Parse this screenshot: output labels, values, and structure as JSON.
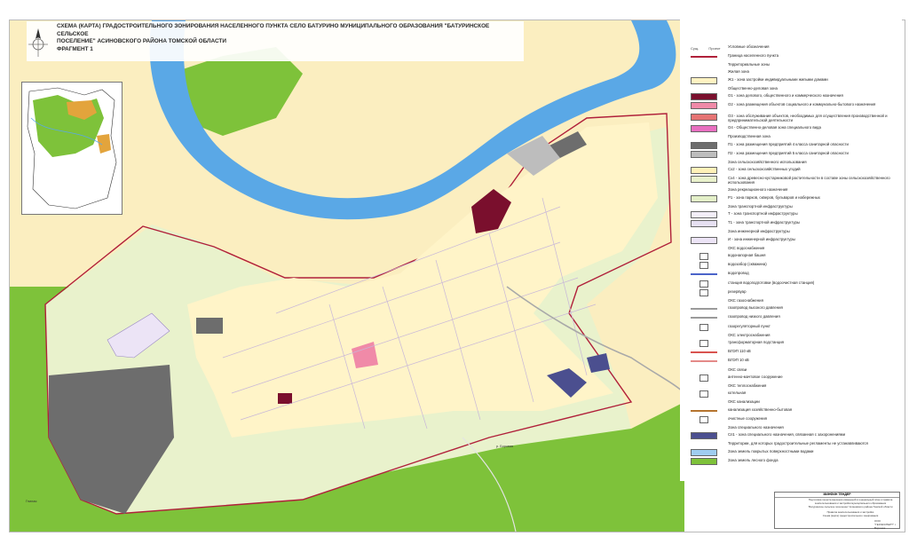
{
  "title": {
    "line1": "СХЕМА (КАРТА) ГРАДОСТРОИТЕЛЬНОГО ЗОНИРОВАНИЯ НАСЕЛЕННОГО ПУНКТА СЕЛО БАТУРИНО МУНИЦИПАЛЬНОГО ОБРАЗОВАНИЯ \"БАТУРИНСКОЕ СЕЛЬСКОЕ",
    "line2": "ПОСЕЛЕНИЕ\" АСИНОВСКОГО РАЙОНА ТОМСКОЙ ОБЛАСТИ",
    "line3": "ФРАГМЕНТ 1"
  },
  "map_labels": {
    "river_label": "р. Боровая",
    "left_river_label": "Гнилая"
  },
  "legend": {
    "head_col1": "Сущ.",
    "head_col2": "Проект",
    "title": "Условные обозначения",
    "items": [
      {
        "section": false,
        "label": "Граница населенного пункта",
        "color": "#b0203a",
        "style": "line"
      },
      {
        "section": true,
        "label": "Территориальные зоны"
      },
      {
        "section": true,
        "label": "Жилая зона"
      },
      {
        "section": false,
        "label": "Ж1 - зона застройки индивидуальными жилыми домами",
        "color": "#fff3c2",
        "style": "fill"
      },
      {
        "section": true,
        "label": "Общественно-деловая зона"
      },
      {
        "section": false,
        "label": "О1 - зона делового, общественного и коммерческого назначения",
        "color": "#7a0f2d",
        "style": "fill"
      },
      {
        "section": false,
        "label": "О2 - зона размещения объектов социального и коммунально-бытового назначения",
        "color": "#f08aa8",
        "style": "fill"
      },
      {
        "section": false,
        "label": "О3 - зона обслуживания объектов, необходимых для осуществления производственной и предпринимательской деятельности",
        "color": "#e57373",
        "style": "fill"
      },
      {
        "section": false,
        "label": "О4 - Общественно-деловая зона специального вида",
        "color": "#e86fc0",
        "style": "fill"
      },
      {
        "section": true,
        "label": "Производственная зона"
      },
      {
        "section": false,
        "label": "П1 - зона размещения предприятий 4 класса санитарной опасности",
        "color": "#6d6d6d",
        "style": "fill"
      },
      {
        "section": false,
        "label": "П2 - зона размещения предприятий 5 класса санитарной опасности",
        "color": "#bdbdbd",
        "style": "fill"
      },
      {
        "section": true,
        "label": "Зона сельскохозяйственного использования"
      },
      {
        "section": false,
        "label": "Сх2 - зона сельскохозяйственных угодий",
        "color": "#fff1b8",
        "style": "fill"
      },
      {
        "section": false,
        "label": "Сх4 - зона древесно-кустарниковой растительности в составе зоны сельскохозяйственного использования",
        "color": "#e9f2cc",
        "style": "fill"
      },
      {
        "section": true,
        "label": "Зона рекреационного назначения"
      },
      {
        "section": false,
        "label": "Р1 - зона парков, скверов, бульваров и набережных",
        "color": "#e3f0c8",
        "style": "fill"
      },
      {
        "section": true,
        "label": "Зона транспортной инфраструктуры"
      },
      {
        "section": false,
        "label": "Т - зона транспортной инфраструктуры",
        "color": "#f3eef8",
        "style": "fill"
      },
      {
        "section": false,
        "label": "Т1 - зона транспортной инфраструктуры",
        "color": "#e6e0f2",
        "style": "fill"
      },
      {
        "section": true,
        "label": "Зона инженерной инфраструктуры"
      },
      {
        "section": false,
        "label": "И - зона инженерной инфраструктуры",
        "color": "#ece4f6",
        "style": "fill"
      },
      {
        "section": true,
        "label": "ОКС водоснабжения"
      },
      {
        "section": false,
        "label": "водонапорная башня",
        "color": "#ffffff",
        "style": "icon"
      },
      {
        "section": false,
        "label": "водозабор (скважина)",
        "color": "#ffffff",
        "style": "icon"
      },
      {
        "section": false,
        "label": "водопровод",
        "color": "#4a63c9",
        "style": "line"
      },
      {
        "section": false,
        "label": "станция водоподготовки (водоочистная станция)",
        "color": "#ffffff",
        "style": "icon"
      },
      {
        "section": false,
        "label": "резервуар",
        "color": "#ffffff",
        "style": "icon"
      },
      {
        "section": true,
        "label": "ОКС газоснабжения"
      },
      {
        "section": false,
        "label": "газопровод высокого давления",
        "color": "#9a9a9a",
        "style": "line"
      },
      {
        "section": false,
        "label": "газопровод низкого давления",
        "color": "#9a9a9a",
        "style": "line"
      },
      {
        "section": false,
        "label": "газорегуляторный пункт",
        "color": "#ffffff",
        "style": "icon"
      },
      {
        "section": true,
        "label": "ОКС электроснабжения"
      },
      {
        "section": false,
        "label": "трансформаторная подстанция",
        "color": "#ffffff",
        "style": "icon"
      },
      {
        "section": false,
        "label": "ВЛЭП 110 кВ",
        "color": "#d9534f",
        "style": "line"
      },
      {
        "section": false,
        "label": "ВЛЭП 10 кВ",
        "color": "#e48a88",
        "style": "line"
      },
      {
        "section": true,
        "label": "ОКС связи"
      },
      {
        "section": false,
        "label": "антенно-мачтовое сооружение",
        "color": "#ffffff",
        "style": "icon"
      },
      {
        "section": true,
        "label": "ОКС теплоснабжения"
      },
      {
        "section": false,
        "label": "котельная",
        "color": "#ffffff",
        "style": "icon"
      },
      {
        "section": true,
        "label": "ОКС канализации"
      },
      {
        "section": false,
        "label": "канализация хозяйственно-бытовая",
        "color": "#b5742f",
        "style": "line"
      },
      {
        "section": false,
        "label": "очистные сооружения",
        "color": "#ffffff",
        "style": "icon"
      },
      {
        "section": true,
        "label": "Зона специального назначения"
      },
      {
        "section": false,
        "label": "Сп1 - зона специального назначения, связанная с захоронениями",
        "color": "#4b4f8f",
        "style": "fill"
      },
      {
        "section": true,
        "label": "Территории, для которых градостроительные регламенты не устанавливаются"
      },
      {
        "section": false,
        "label": "Зона земель покрытых поверхностными водами",
        "color": "#9fcdf0",
        "style": "fill"
      },
      {
        "section": false,
        "label": "Зона земель лесного фонда",
        "color": "#7ec23a",
        "style": "fill"
      }
    ]
  },
  "stamp": {
    "top": "МИНФИН ТЕНДЕР",
    "line1": "Подготовка проекта внесения изменений в генеральный план и правила",
    "line2": "землепользования и застройки муниципального образования",
    "line3": "\"Батуринское сельское поселение\" Асиновского района Томской области",
    "line4": "Правила землепользования и застройки",
    "line5": "Схема (карта) градостроительного зонирования",
    "org": "ООО \"ГЕОЭКСПЕРТ\" г. Воронеж"
  },
  "colors": {
    "forest": "#7ec23a",
    "agri": "#fbeec0",
    "residential": "#fff4c8",
    "shrub": "#e9f2cc",
    "river": "#5aa8e6",
    "boundary": "#b0203a",
    "industrial": "#6d6d6d",
    "business": "#7a0f2d"
  }
}
